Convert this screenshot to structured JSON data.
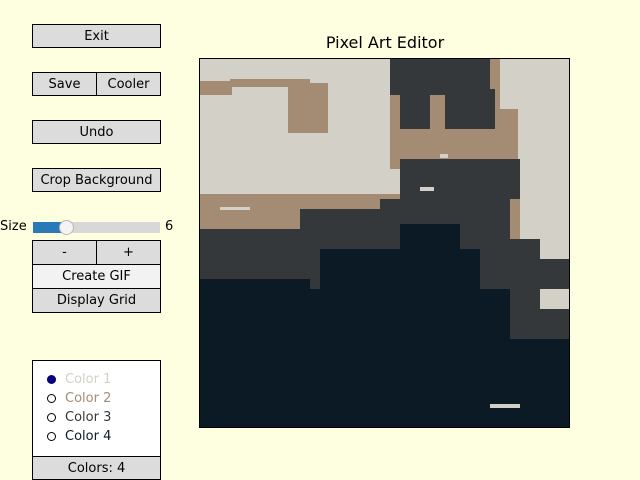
{
  "app": {
    "title": "Pixel Art Editor"
  },
  "buttons": {
    "exit": "Exit",
    "save": "Save",
    "cooler": "Cooler",
    "undo": "Undo",
    "crop_background": "Crop Background",
    "decrease": "-",
    "increase": "+",
    "create_gif": "Create GIF",
    "display_grid": "Display Grid"
  },
  "size_slider": {
    "label": "Size",
    "value": "6",
    "min": 1,
    "max": 20,
    "fraction": 0.26
  },
  "colors": {
    "palette": [
      "#d3d0c7",
      "#a48c74",
      "#34383a",
      "#0c1a26"
    ],
    "options": [
      {
        "label": "Color 1",
        "selected": true,
        "color": "#d3d0c7"
      },
      {
        "label": "Color 2",
        "selected": false,
        "color": "#a48c74"
      },
      {
        "label": "Color 3",
        "selected": false,
        "color": "#34383a"
      },
      {
        "label": "Color 4",
        "selected": false,
        "color": "#0c1a26"
      }
    ],
    "count_label": "Colors: 4"
  }
}
